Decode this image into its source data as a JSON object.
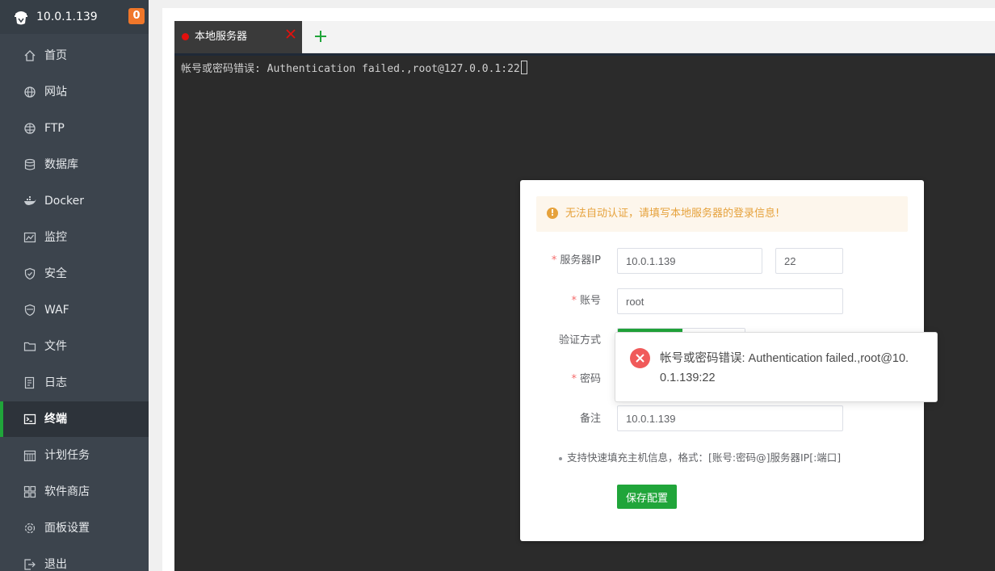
{
  "sidebar": {
    "host": "10.0.1.139",
    "badge": "0",
    "items": [
      {
        "label": "首页",
        "icon": "home-icon"
      },
      {
        "label": "网站",
        "icon": "globe-icon"
      },
      {
        "label": "FTP",
        "icon": "ftp-globe-icon"
      },
      {
        "label": "数据库",
        "icon": "database-icon"
      },
      {
        "label": "Docker",
        "icon": "docker-icon"
      },
      {
        "label": "监控",
        "icon": "monitor-chart-icon"
      },
      {
        "label": "安全",
        "icon": "shield-icon"
      },
      {
        "label": "WAF",
        "icon": "waf-shield-icon"
      },
      {
        "label": "文件",
        "icon": "folder-icon"
      },
      {
        "label": "日志",
        "icon": "log-document-icon"
      },
      {
        "label": "终端",
        "icon": "terminal-icon",
        "active": true
      },
      {
        "label": "计划任务",
        "icon": "calendar-icon"
      },
      {
        "label": "软件商店",
        "icon": "app-grid-icon"
      },
      {
        "label": "面板设置",
        "icon": "gear-icon"
      },
      {
        "label": "退出",
        "icon": "logout-icon"
      }
    ]
  },
  "tabs": [
    {
      "label": "本地服务器",
      "status_color": "#e3100d"
    }
  ],
  "terminal": {
    "output": "帐号或密码错误: Authentication failed.,root@127.0.0.1:22"
  },
  "dialog": {
    "warning": "无法自动认证，请填写本地服务器的登录信息!",
    "fields": {
      "server_ip_label": "服务器IP",
      "server_ip_value": "10.0.1.139",
      "port_value": "22",
      "account_label": "账号",
      "account_value": "root",
      "auth_label": "验证方式",
      "password_label": "密码",
      "remark_label": "备注",
      "remark_value": "10.0.1.139"
    },
    "hint": "支持快速填充主机信息，格式：[账号:密码@]服务器IP[:端口]",
    "save_label": "保存配置"
  },
  "toast": {
    "message": "帐号或密码错误: Authentication failed.,root@10.0.1.139:22"
  },
  "colors": {
    "accent": "#20a53a",
    "warning": "#e6a23c",
    "error": "#f05a5a",
    "sidebar_bg": "#3c444d"
  }
}
